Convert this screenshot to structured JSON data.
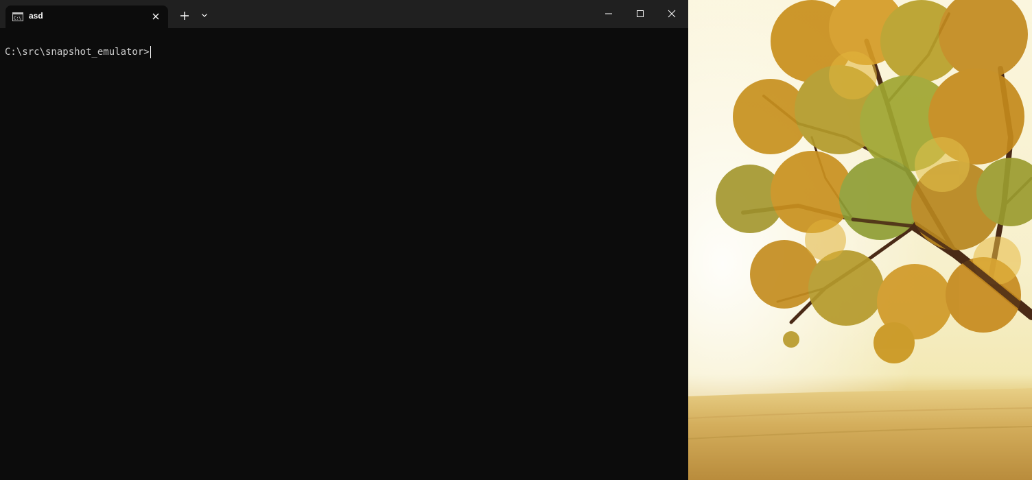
{
  "terminal": {
    "tab": {
      "title": "asd",
      "icon": "cmd-icon"
    },
    "toolbar": {
      "new_tab_icon": "plus-icon",
      "dropdown_icon": "chevron-down-icon"
    },
    "window_controls": [
      "minimize-icon",
      "maximize-icon",
      "close-icon"
    ],
    "console": {
      "prompt": "C:\\src\\snapshot_emulator>"
    },
    "colors": {
      "background": "#0c0c0c",
      "titlebar": "#202020",
      "text": "#cccccc"
    }
  },
  "desktop": {
    "wallpaper": "autumn tree in golden field"
  }
}
